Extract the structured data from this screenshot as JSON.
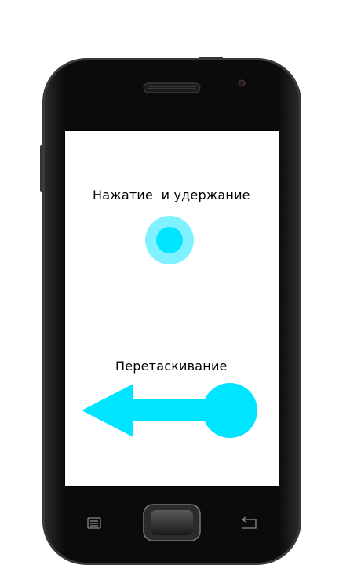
{
  "screen": {
    "press_hold_label": "Нажатие  и удержание",
    "drag_label": "Перетаскивание"
  },
  "colors": {
    "accent": "#00e5ff",
    "accent_light": "#80f2ff",
    "phone_body": "#111111",
    "phone_bezel": "#000000",
    "screen": "#ffffff"
  },
  "icons": {
    "menu_key": "menu-icon",
    "back_key": "back-icon",
    "drag_arrow": "arrow-left-icon"
  }
}
